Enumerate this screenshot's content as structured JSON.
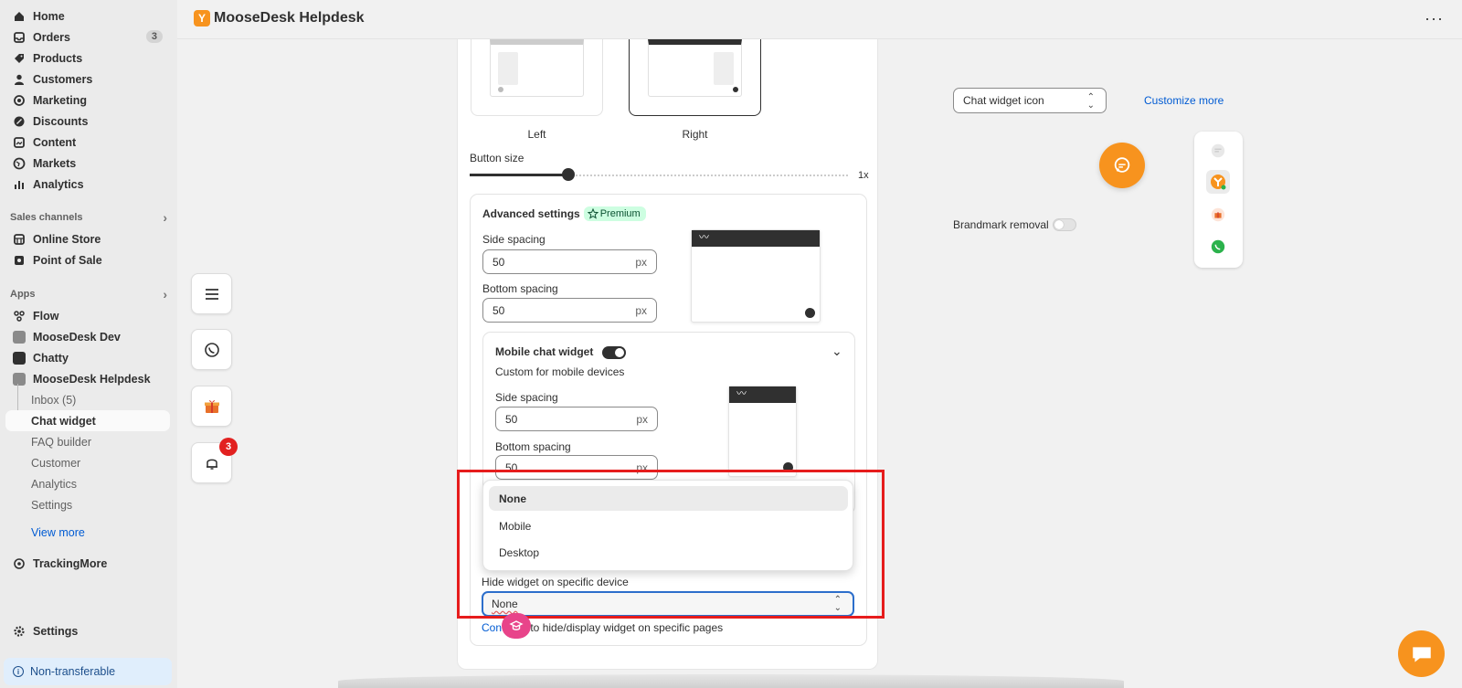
{
  "sidebar": {
    "main_items": [
      {
        "label": "Home",
        "icon": "home-icon"
      },
      {
        "label": "Orders",
        "icon": "orders-icon",
        "count": "3"
      },
      {
        "label": "Products",
        "icon": "products-icon"
      },
      {
        "label": "Customers",
        "icon": "customers-icon"
      },
      {
        "label": "Marketing",
        "icon": "marketing-icon"
      },
      {
        "label": "Discounts",
        "icon": "discounts-icon"
      },
      {
        "label": "Content",
        "icon": "content-icon"
      },
      {
        "label": "Markets",
        "icon": "markets-icon"
      },
      {
        "label": "Analytics",
        "icon": "analytics-icon"
      }
    ],
    "sales_channels_title": "Sales channels",
    "sales_channels": [
      {
        "label": "Online Store",
        "icon": "online-store-icon"
      },
      {
        "label": "Point of Sale",
        "icon": "point-of-sale-icon"
      }
    ],
    "apps_title": "Apps",
    "apps": [
      {
        "label": "Flow"
      },
      {
        "label": "MooseDesk Dev"
      },
      {
        "label": "Chatty"
      },
      {
        "label": "MooseDesk Helpdesk"
      }
    ],
    "sub_items": [
      {
        "label": "Inbox (5)"
      },
      {
        "label": "Chat widget"
      },
      {
        "label": "FAQ builder"
      },
      {
        "label": "Customer"
      },
      {
        "label": "Analytics"
      },
      {
        "label": "Settings"
      }
    ],
    "view_more": "View more",
    "tracking": "TrackingMore",
    "settings": "Settings",
    "non_transferable": "Non-transferable"
  },
  "topbar": {
    "app_title": "MooseDesk Helpdesk",
    "more_icon": "more-dots-icon"
  },
  "float_buttons": {
    "notification_count": "3"
  },
  "position": {
    "left_label": "Left",
    "right_label": "Right",
    "selected": "Right"
  },
  "button_size": {
    "label": "Button size",
    "value_label": "1x",
    "level": 0.26
  },
  "advanced": {
    "title": "Advanced settings",
    "premium": "Premium",
    "side_spacing_label": "Side spacing",
    "side_spacing_value": "50",
    "bottom_spacing_label": "Bottom spacing",
    "bottom_spacing_value": "50",
    "unit": "px"
  },
  "mobile": {
    "title": "Mobile chat widget",
    "subtitle": "Custom for mobile devices",
    "side_spacing_label": "Side spacing",
    "side_spacing_value": "50",
    "bottom_spacing_label": "Bottom spacing",
    "bottom_spacing_value": "50",
    "unit": "px",
    "enabled": true
  },
  "dropdown": {
    "options": [
      "None",
      "Mobile",
      "Desktop"
    ],
    "selected": "None"
  },
  "hide_widget": {
    "label": "Hide widget on specific device",
    "value": "None"
  },
  "footer_text": {
    "link_part": "Con",
    "rest": "s to hide/display widget on specific pages"
  },
  "right_panel": {
    "select_value": "Chat widget icon",
    "customize_link": "Customize more",
    "brandmark_label": "Brandmark removal",
    "brandmark_enabled": false
  },
  "colors": {
    "accent_orange": "#f7931e",
    "link_blue": "#005bd3",
    "highlight_red": "#e61c1c",
    "premium_green": "#cdfee1"
  }
}
